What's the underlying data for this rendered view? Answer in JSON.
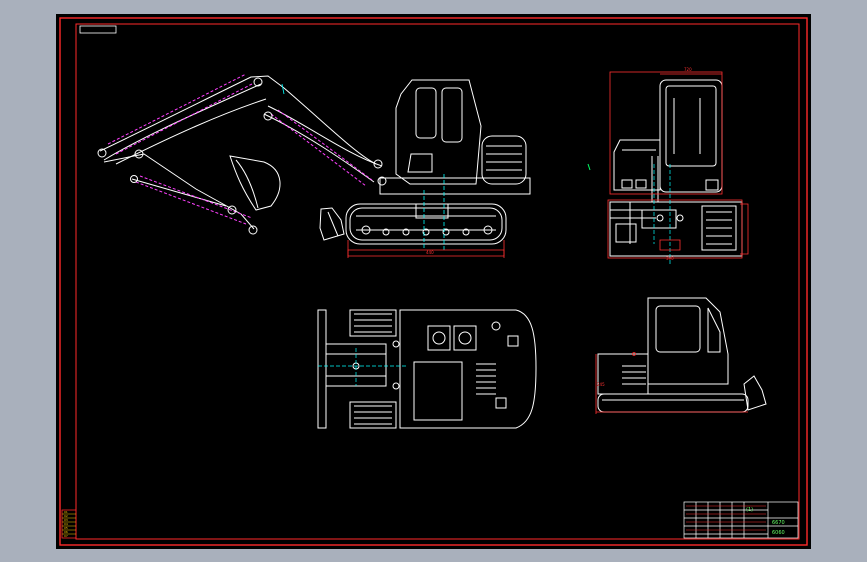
{
  "drawing": {
    "colors": {
      "background": "#000000",
      "workspace": "#a9b0bc",
      "frame": "#ff2a2a",
      "geometry": "#ffffff",
      "dimension": "#ff3030",
      "hidden": "#ff40ff",
      "center": "#00ffff",
      "accent": "#00ff66",
      "titleText": "#66ff66"
    },
    "views": {
      "front": "front-view",
      "side": "side-view",
      "top": "top-view",
      "rear": "rear-view"
    },
    "dimensions": {
      "track_length": "440",
      "cab_width": "720",
      "track_width": "390",
      "height": "245"
    },
    "title_block": {
      "label": "(1)",
      "number": "6670",
      "code": "6060"
    },
    "side_strip": [
      "01",
      "02",
      "03",
      "04",
      "05",
      "06",
      "07"
    ]
  }
}
